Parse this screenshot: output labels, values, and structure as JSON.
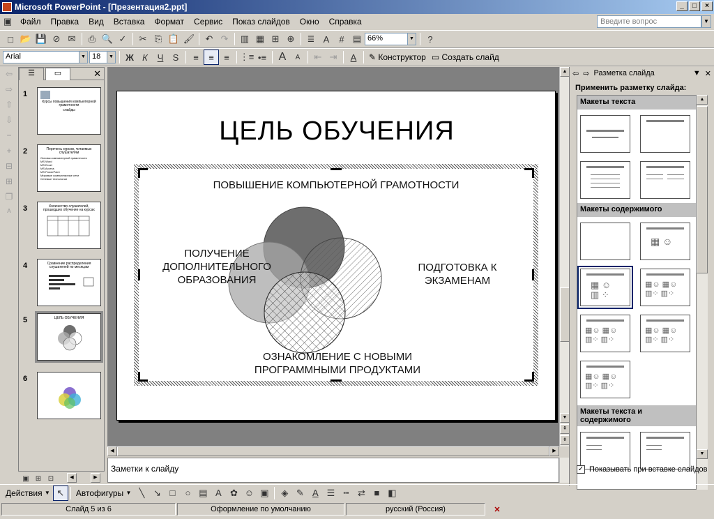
{
  "window": {
    "title": "Microsoft PowerPoint - [Презентация2.ppt]",
    "minimize": "_",
    "maximize": "□",
    "close": "×"
  },
  "menu": {
    "items": [
      "Файл",
      "Правка",
      "Вид",
      "Вставка",
      "Формат",
      "Сервис",
      "Показ слайдов",
      "Окно",
      "Справка"
    ],
    "ask_placeholder": "Введите вопрос"
  },
  "toolbar_standard": {
    "zoom": "66%"
  },
  "toolbar_format": {
    "font": "Arial",
    "size": "18",
    "bold": "Ж",
    "italic": "К",
    "underline": "Ч",
    "shadow": "S",
    "designer": "Конструктор",
    "new_slide": "Создать слайд"
  },
  "slides_pane": {
    "thumbs": [
      {
        "num": "1",
        "title": "Курсы повышения компьютерной грамотности",
        "subtitle": "слайды"
      },
      {
        "num": "2",
        "title": "Перечень курсов, читаемых слушателям",
        "lines": [
          "Основы компьютерной грамотности",
          "MS Word",
          "MS Excel",
          "MS Access",
          "MS PowerPoint",
          "Мировые компьютерные сети",
          "Сетевые технологии"
        ]
      },
      {
        "num": "3",
        "title": "Количество слушателей, прошедших обучение на курсах"
      },
      {
        "num": "4",
        "title": "Сравнение распределения слушателей по месяцам"
      },
      {
        "num": "5",
        "title": "ЦЕЛЬ ОБУЧЕНИЯ"
      },
      {
        "num": "6",
        "title": ""
      }
    ]
  },
  "slide": {
    "title": "ЦЕЛЬ ОБУЧЕНИЯ",
    "labels": {
      "top": "ПОВЫШЕНИЕ КОМПЬЮТЕРНОЙ ГРАМОТНОСТИ",
      "left": "ПОЛУЧЕНИЕ ДОПОЛНИТЕЛЬНОГО ОБРАЗОВАНИЯ",
      "right": "ПОДГОТОВКА К ЭКЗАМЕНАМ",
      "bottom": "ОЗНАКОМЛЕНИЕ С НОВЫМИ ПРОГРАММНЫМИ ПРОДУКТАМИ"
    }
  },
  "notes": {
    "placeholder": "Заметки к слайду"
  },
  "taskpane": {
    "title": "Разметка слайда",
    "apply_label": "Применить разметку слайда:",
    "sections": [
      "Макеты текста",
      "Макеты содержимого",
      "Макеты текста и содержимого"
    ],
    "show_on_insert": "Показывать при вставке слайдов",
    "checked": true
  },
  "drawbar": {
    "actions": "Действия",
    "autoshapes": "Автофигуры"
  },
  "status": {
    "slide": "Слайд 5 из 6",
    "design": "Оформление по умолчанию",
    "language": "русский (Россия)"
  },
  "colors": {
    "titlebar": "#0a246a",
    "circle_dark": "#6e6e6e",
    "circle_light": "#a8a8a8"
  }
}
